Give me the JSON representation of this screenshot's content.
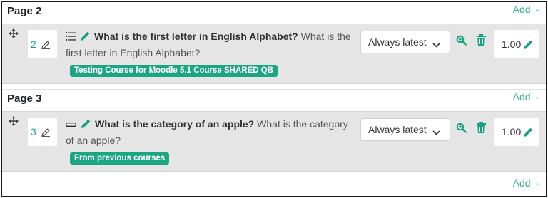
{
  "sections": [
    {
      "title": "Page 2",
      "add_label": "Add",
      "slot": {
        "number": "2",
        "question_type_icon": "multiple-choice-icon",
        "question_name": "What is the first letter in English Alphabet?",
        "question_text_line1": "What is the",
        "question_text_line2": "first letter in English Alphabet?",
        "bank_badge": "Testing Course for Moodle 5.1 Course SHARED QB",
        "version": "Always latest",
        "mark": "1.00"
      }
    },
    {
      "title": "Page 3",
      "add_label": "Add",
      "slot": {
        "number": "3",
        "question_type_icon": "true-false-icon",
        "question_name": "What is the category of an apple?",
        "question_text_line1": "What is the category",
        "question_text_line2": "of an apple?",
        "bank_badge": "From previous courses",
        "version": "Always latest",
        "mark": "1.00"
      }
    }
  ],
  "footer": {
    "add_label": "Add"
  },
  "colors": {
    "accent": "#16a085",
    "badge": "#1aa682",
    "slot_bg": "#e5e5e5"
  }
}
